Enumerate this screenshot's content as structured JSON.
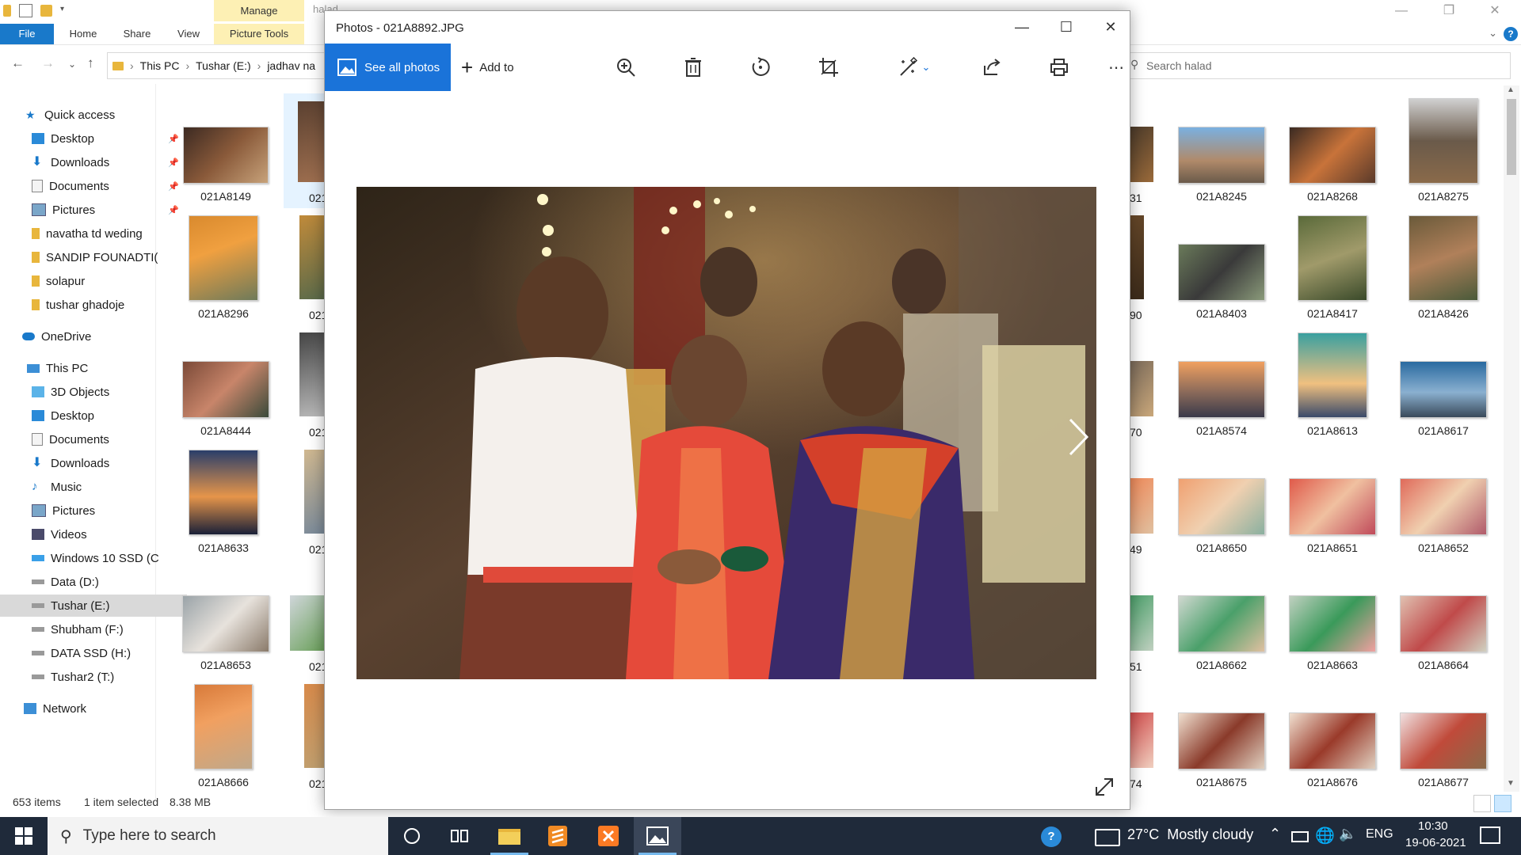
{
  "explorer": {
    "manage_tab": "Manage",
    "title_hint": "halad",
    "ribbon_tabs": [
      "File",
      "Home",
      "Share",
      "View",
      "Picture Tools"
    ],
    "address": [
      "This PC",
      "Tushar (E:)",
      "jadhav na"
    ],
    "search_placeholder": "Search halad",
    "sidebar": [
      {
        "label": "Quick access",
        "icon": "star-icon"
      },
      {
        "label": "Desktop",
        "icon": "desktop-icon",
        "pinned": true
      },
      {
        "label": "Downloads",
        "icon": "download-icon",
        "pinned": true
      },
      {
        "label": "Documents",
        "icon": "documents-icon",
        "pinned": true
      },
      {
        "label": "Pictures",
        "icon": "pictures-icon",
        "pinned": true
      },
      {
        "label": "navatha td weding",
        "icon": "folder-icon"
      },
      {
        "label": "SANDIP FOUNADTI(",
        "icon": "folder-icon"
      },
      {
        "label": "solapur",
        "icon": "folder-icon"
      },
      {
        "label": "tushar ghadoje",
        "icon": "folder-icon"
      },
      {
        "label": "OneDrive",
        "icon": "cloud-icon"
      },
      {
        "label": "This PC",
        "icon": "computer-icon"
      },
      {
        "label": "3D Objects",
        "icon": "3d-objects-icon"
      },
      {
        "label": "Desktop",
        "icon": "desktop-icon"
      },
      {
        "label": "Documents",
        "icon": "documents-icon"
      },
      {
        "label": "Downloads",
        "icon": "download-icon"
      },
      {
        "label": "Music",
        "icon": "music-icon"
      },
      {
        "label": "Pictures",
        "icon": "pictures-icon"
      },
      {
        "label": "Videos",
        "icon": "videos-icon"
      },
      {
        "label": "Windows 10 SSD (C",
        "icon": "windows-drive-icon"
      },
      {
        "label": "Data (D:)",
        "icon": "drive-icon"
      },
      {
        "label": "Tushar (E:)",
        "icon": "drive-icon",
        "selected": true
      },
      {
        "label": "Shubham (F:)",
        "icon": "drive-icon"
      },
      {
        "label": "DATA SSD (H:)",
        "icon": "drive-icon"
      },
      {
        "label": "Tushar2 (T:)",
        "icon": "drive-icon"
      },
      {
        "label": "Network",
        "icon": "network-icon"
      }
    ],
    "left_col": [
      "021A8149",
      "021A8296",
      "021A8444",
      "021A8633",
      "021A8653",
      "021A8666"
    ],
    "col2_partial": [
      "021",
      "021",
      "021",
      "021",
      "021",
      "021"
    ],
    "col3_partial": [
      "31",
      "90",
      "70",
      "49",
      "51",
      "74"
    ],
    "right_cols": [
      [
        "021A8245",
        "021A8268",
        "021A8275"
      ],
      [
        "021A8403",
        "021A8417",
        "021A8426"
      ],
      [
        "021A8574",
        "021A8613",
        "021A8617"
      ],
      [
        "021A8650",
        "021A8651",
        "021A8652"
      ],
      [
        "021A8662",
        "021A8663",
        "021A8664"
      ],
      [
        "021A8675",
        "021A8676",
        "021A8677"
      ]
    ],
    "status": {
      "count": "653 items",
      "selected": "1 item selected",
      "size": "8.38 MB"
    }
  },
  "photos": {
    "title": "Photos - 021A8892.JPG",
    "see_all": "See all photos",
    "add_to": "Add to",
    "accent": "#1a73d9"
  },
  "taskbar": {
    "search_placeholder": "Type here to search",
    "weather": "27°C  Mostly cloudy",
    "lang": "ENG",
    "time": "10:30",
    "date": "19-06-2021"
  }
}
